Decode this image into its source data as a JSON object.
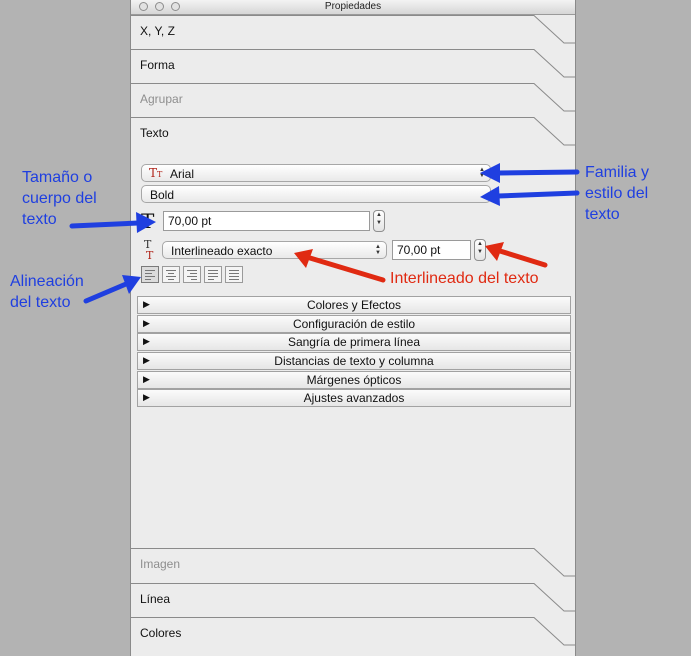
{
  "window": {
    "title": "Propiedades"
  },
  "sections_top": [
    {
      "label": "X, Y, Z",
      "enabled": true
    },
    {
      "label": "Forma",
      "enabled": true
    },
    {
      "label": "Agrupar",
      "enabled": false
    },
    {
      "label": "Texto",
      "enabled": true
    }
  ],
  "text_panel": {
    "font_family": "Arial",
    "font_style": "Bold",
    "font_size": "70,00 pt",
    "leading_mode": "Interlineado exacto",
    "leading_value": "70,00 pt",
    "font_family_icon": "font-tt-icon",
    "font_size_icon": "text-size-icon",
    "leading_icon": "line-spacing-icon",
    "alignment_options": [
      "align-left",
      "align-center",
      "align-right",
      "justify",
      "justify-all"
    ],
    "alignment_selected": "align-left"
  },
  "collapsible_rows": [
    "Colores y Efectos",
    "Configuración de estilo",
    "Sangría de primera línea",
    "Distancias de texto y columna",
    "Márgenes ópticos",
    "Ajustes avanzados"
  ],
  "sections_bottom": [
    {
      "label": "Imagen",
      "enabled": false
    },
    {
      "label": "Línea",
      "enabled": true
    },
    {
      "label": "Colores",
      "enabled": true
    }
  ],
  "annotations": {
    "size_line1": "Tamaño o",
    "size_line2": "cuerpo del",
    "size_line3": "texto",
    "family_line1": "Familia y",
    "family_line2": "estilo del",
    "family_line3": "texto",
    "align_line1": "Alineación",
    "align_line2": "del texto",
    "leading": "Interlineado del texto",
    "blue_color": "#1f3fe0",
    "red_color": "#e02a12"
  }
}
